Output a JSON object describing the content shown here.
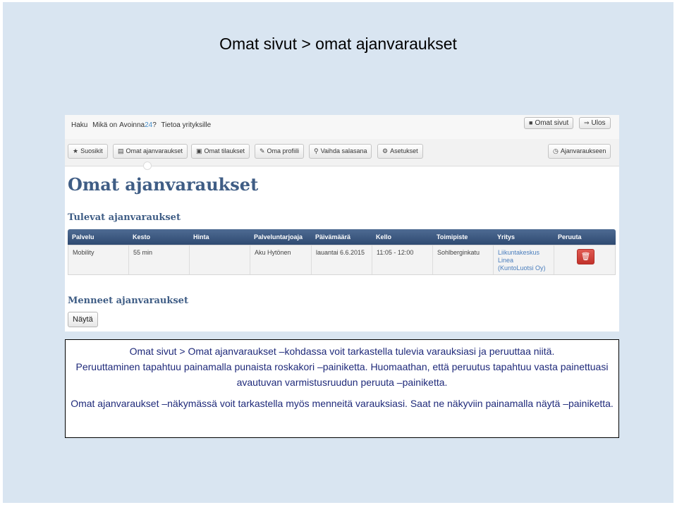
{
  "slide": {
    "title": "Omat sivut > omat ajanvaraukset"
  },
  "screenshot": {
    "topbar": {
      "nav": [
        "Haku",
        "Mikä on",
        "Avoinna",
        "24",
        "?",
        "Tietoa yrityksille"
      ],
      "omat_sivut": "Omat sivut",
      "ulos": "Ulos"
    },
    "menu": {
      "suosikit": "Suosikit",
      "omat_ajanvaraukset": "Omat ajanvaraukset",
      "omat_tilaukset": "Omat tilaukset",
      "oma_profiili": "Oma profiili",
      "vaihda_salasana": "Vaihda salasana",
      "asetukset": "Asetukset",
      "ajanvaraukseen": "Ajanvaraukseen"
    },
    "page_title": "Omat ajanvaraukset",
    "upcoming_heading": "Tulevat ajanvaraukset",
    "columns": [
      "Palvelu",
      "Kesto",
      "Hinta",
      "Palveluntarjoaja",
      "Päivämäärä",
      "Kello",
      "Toimipiste",
      "Yritys",
      "Peruuta"
    ],
    "rows": [
      {
        "palvelu": "Mobility",
        "kesto": "55 min",
        "hinta": "",
        "palveluntarjoaja": "Aku Hytönen",
        "paivamaara": "lauantai 6.6.2015",
        "kello": "11:05 - 12:00",
        "toimipiste": "Sohlberginkatu",
        "yritys_1": "Liikuntakeskus",
        "yritys_2": "Linea",
        "yritys_3": "(KuntoLuotsi Oy)"
      }
    ],
    "past_heading": "Menneet ajanvaraukset",
    "show_button": "Näytä"
  },
  "caption": {
    "line1": "Omat sivut > Omat ajanvaraukset –kohdassa voit tarkastella tulevia varauksiasi ja peruuttaa niitä.",
    "line2": "Peruuttaminen tapahtuu painamalla punaista roskakori –painiketta. Huomaathan, että peruutus tapahtuu vasta painettuasi avautuvan varmistusruudun peruuta –painiketta.",
    "line3": "Omat ajanvaraukset –näkymässä voit tarkastella myös menneitä varauksiasi. Saat ne näkyviin painamalla näytä –painiketta."
  },
  "icons": {
    "star": "star-icon",
    "book": "book-icon",
    "cart": "cart-icon",
    "pencil": "pencil-icon",
    "key": "key-icon",
    "gear": "gear-icon",
    "clock": "clock-icon",
    "user": "user-icon",
    "logout": "logout-icon",
    "trash": "trash-icon"
  },
  "colors": {
    "slide_bg": "#d9e5f1",
    "heading": "#3f5d85",
    "table_header": "#3a557c",
    "danger": "#d9443c",
    "link": "#4a7ebd",
    "caption_text": "#1f2a7a"
  }
}
